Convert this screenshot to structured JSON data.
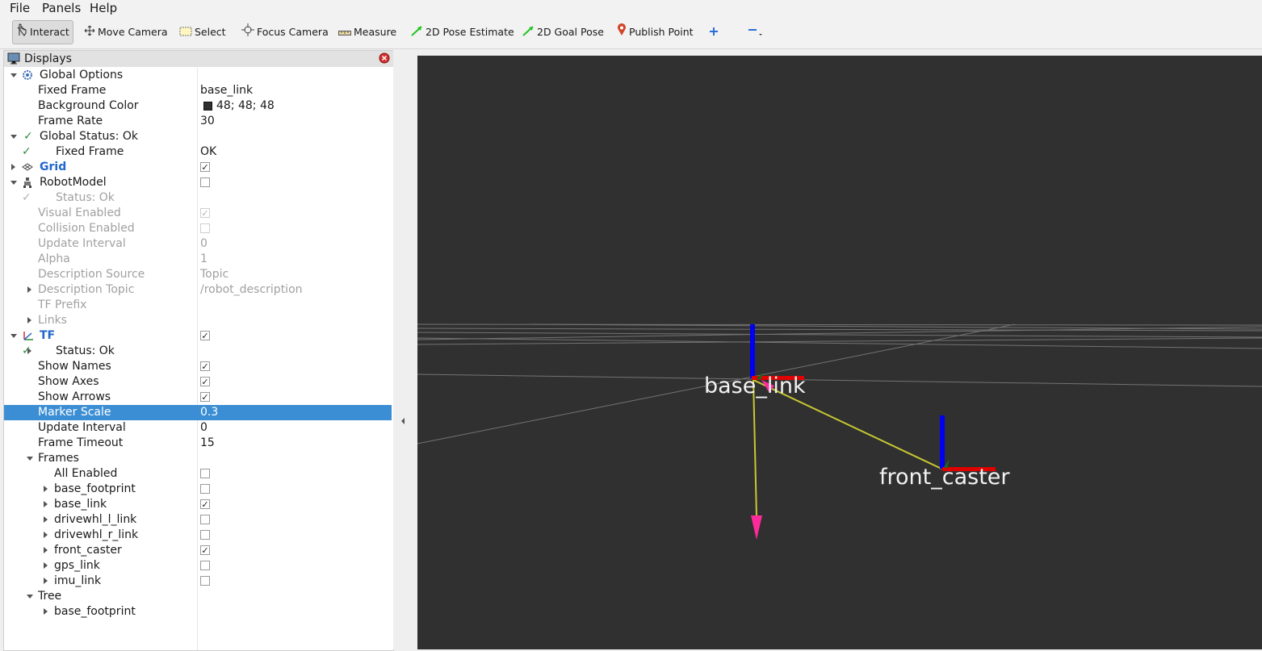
{
  "menu": {
    "file": "File",
    "panels": "Panels",
    "help": "Help"
  },
  "toolbar": {
    "interact": "Interact",
    "move_camera": "Move Camera",
    "select": "Select",
    "focus_camera": "Focus Camera",
    "measure": "Measure",
    "pose_estimate": "2D Pose Estimate",
    "goal_pose": "2D Goal Pose",
    "publish_point": "Publish Point"
  },
  "panel": {
    "title": "Displays"
  },
  "tree": [
    {
      "label": "Global Options",
      "value": "",
      "indent": 0,
      "expand": "down",
      "icon": "gear-icon"
    },
    {
      "label": "Fixed Frame",
      "value": "base_link",
      "indent": 1
    },
    {
      "label": "Background Color",
      "value": "48; 48; 48",
      "indent": 1,
      "swatch": "#303030"
    },
    {
      "label": "Frame Rate",
      "value": "30",
      "indent": 1
    },
    {
      "label": "Global Status: Ok",
      "value": "",
      "indent": 0,
      "expand": "down",
      "icon": "check-icon"
    },
    {
      "label": "Fixed Frame",
      "value": "OK",
      "indent": 1,
      "icon": "check-icon"
    },
    {
      "label": "Grid",
      "value": "",
      "indent": 0,
      "expand": "right",
      "icon": "grid-icon",
      "checkbox": true,
      "blue": true
    },
    {
      "label": "RobotModel",
      "value": "",
      "indent": 0,
      "expand": "down",
      "icon": "robot-icon",
      "checkbox": false
    },
    {
      "label": "Status: Ok",
      "value": "",
      "indent": 1,
      "icon": "check-icon",
      "disabled": true
    },
    {
      "label": "Visual Enabled",
      "value": "",
      "indent": 1,
      "checkbox": true,
      "disabled": true
    },
    {
      "label": "Collision Enabled",
      "value": "",
      "indent": 1,
      "checkbox": false,
      "disabled": true
    },
    {
      "label": "Update Interval",
      "value": "0",
      "indent": 1,
      "disabled": true
    },
    {
      "label": "Alpha",
      "value": "1",
      "indent": 1,
      "disabled": true
    },
    {
      "label": "Description Source",
      "value": "Topic",
      "indent": 1,
      "disabled": true
    },
    {
      "label": "Description Topic",
      "value": "/robot_description",
      "indent": 1,
      "expand": "right",
      "disabled": true
    },
    {
      "label": "TF Prefix",
      "value": "",
      "indent": 1,
      "disabled": true
    },
    {
      "label": "Links",
      "value": "",
      "indent": 1,
      "expand": "right",
      "disabled": true
    },
    {
      "label": "TF",
      "value": "",
      "indent": 0,
      "expand": "down",
      "icon": "tf-icon",
      "checkbox": true,
      "blue": true
    },
    {
      "label": "Status: Ok",
      "value": "",
      "indent": 1,
      "expand": "right",
      "icon": "check-icon"
    },
    {
      "label": "Show Names",
      "value": "",
      "indent": 1,
      "checkbox": true
    },
    {
      "label": "Show Axes",
      "value": "",
      "indent": 1,
      "checkbox": true
    },
    {
      "label": "Show Arrows",
      "value": "",
      "indent": 1,
      "checkbox": true
    },
    {
      "label": "Marker Scale",
      "value": "0.3",
      "indent": 1,
      "selected": true
    },
    {
      "label": "Update Interval",
      "value": "0",
      "indent": 1
    },
    {
      "label": "Frame Timeout",
      "value": "15",
      "indent": 1
    },
    {
      "label": "Frames",
      "value": "",
      "indent": 1,
      "expand": "down"
    },
    {
      "label": "All Enabled",
      "value": "",
      "indent": 2,
      "checkbox": false
    },
    {
      "label": "base_footprint",
      "value": "",
      "indent": 2,
      "expand": "right",
      "checkbox": false
    },
    {
      "label": "base_link",
      "value": "",
      "indent": 2,
      "expand": "right",
      "checkbox": true
    },
    {
      "label": "drivewhl_l_link",
      "value": "",
      "indent": 2,
      "expand": "right",
      "checkbox": false
    },
    {
      "label": "drivewhl_r_link",
      "value": "",
      "indent": 2,
      "expand": "right",
      "checkbox": false
    },
    {
      "label": "front_caster",
      "value": "",
      "indent": 2,
      "expand": "right",
      "checkbox": true
    },
    {
      "label": "gps_link",
      "value": "",
      "indent": 2,
      "expand": "right",
      "checkbox": false
    },
    {
      "label": "imu_link",
      "value": "",
      "indent": 2,
      "expand": "right",
      "checkbox": false
    },
    {
      "label": "Tree",
      "value": "",
      "indent": 1,
      "expand": "down"
    },
    {
      "label": "base_footprint",
      "value": "",
      "indent": 2,
      "expand": "right"
    }
  ],
  "viewport": {
    "frames": [
      "base_link",
      "front_caster"
    ],
    "background": "#303030",
    "colors": {
      "x_axis": "#e00000",
      "z_axis": "#0000ee",
      "link": "#c8c832",
      "arrow": "#ff2a9a"
    }
  }
}
